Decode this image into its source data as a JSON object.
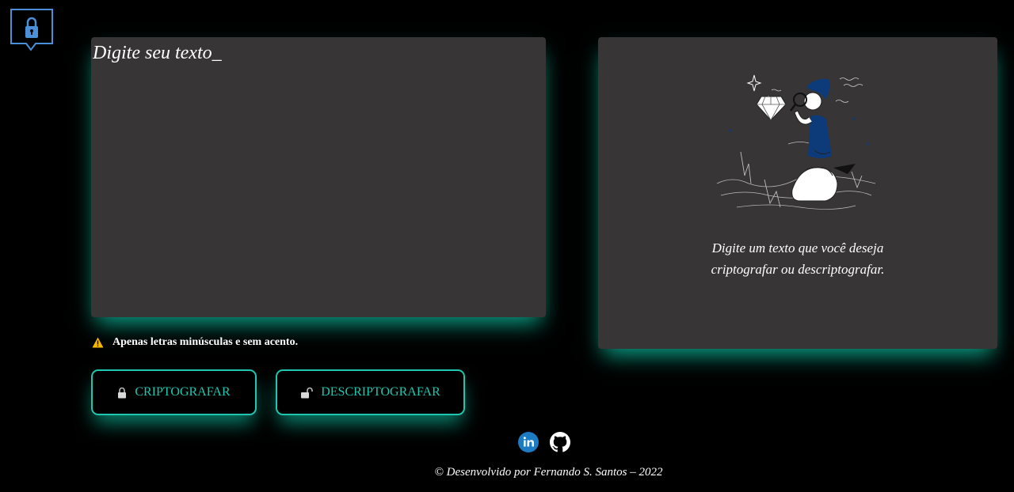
{
  "logo": {
    "icon": "padlock-icon"
  },
  "input": {
    "placeholder": "Digite seu texto_",
    "value": ""
  },
  "warning": {
    "icon": "warning-icon",
    "text": "Apenas letras minúsculas e sem acento."
  },
  "buttons": {
    "encrypt": {
      "icon": "lock-closed-icon",
      "label": "CRIPTOGRAFAR"
    },
    "decrypt": {
      "icon": "lock-open-icon",
      "label": "DESCRIPTOGRAFAR"
    }
  },
  "output": {
    "illustration": "person-with-magnifier-and-diamond-illustration",
    "message_line1": "Digite um texto que você deseja",
    "message_line2": "criptografar ou descriptografar."
  },
  "social": {
    "linkedin": {
      "icon": "linkedin-icon"
    },
    "github": {
      "icon": "github-icon"
    }
  },
  "footer": {
    "text": "© Desenvolvido por Fernando S. Santos – 2022"
  },
  "colors": {
    "background": "#000000",
    "panel": "#373535",
    "accent": "#1fc6b0",
    "logo_blue": "#4a90d9",
    "illustration_blue": "#0d3b7a"
  }
}
